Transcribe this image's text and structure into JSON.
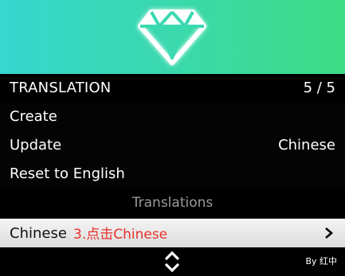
{
  "banner": {
    "icon": "diamond-icon"
  },
  "header": {
    "title": "TRANSLATION",
    "count": "5 / 5"
  },
  "menu": {
    "items": [
      {
        "label": "Create",
        "value": ""
      },
      {
        "label": "Update",
        "value": "Chinese"
      },
      {
        "label": "Reset to English",
        "value": ""
      }
    ],
    "separator": "Translations",
    "selected": {
      "label": "Chinese",
      "annotation": "3.点击Chinese",
      "icon": "chevron-right-icon"
    }
  },
  "footer": {
    "icon": "up-down-arrows-icon",
    "credit": "By 红中"
  },
  "colors": {
    "banner_left": "#37d6cf",
    "banner_right": "#3ddc84",
    "annotation": "#e8322b",
    "selected_bg": "#e8e8e8"
  }
}
